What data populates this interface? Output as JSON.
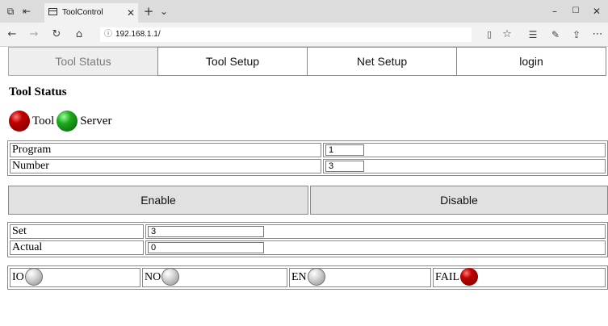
{
  "browser": {
    "tab_title": "ToolControl",
    "url": "192.168.1.1/"
  },
  "nav": {
    "items": [
      {
        "label": "Tool Status",
        "active": true
      },
      {
        "label": "Tool Setup",
        "active": false
      },
      {
        "label": "Net Setup",
        "active": false
      },
      {
        "label": "login",
        "active": false
      }
    ]
  },
  "page": {
    "title": "Tool Status"
  },
  "status": {
    "tool_label": "Tool",
    "tool_color": "#c20000",
    "server_label": "Server",
    "server_color": "#1ca81c"
  },
  "program": {
    "program_label": "Program",
    "program_value": "1",
    "number_label": "Number",
    "number_value": "3"
  },
  "controls": {
    "enable_label": "Enable",
    "disable_label": "Disable"
  },
  "counts": {
    "set_label": "Set",
    "set_value": "3",
    "actual_label": "Actual",
    "actual_value": "0"
  },
  "io": {
    "items": [
      {
        "label": "IO",
        "state": "off",
        "color": "#d4d4d4"
      },
      {
        "label": "NO",
        "state": "off",
        "color": "#d4d4d4"
      },
      {
        "label": "EN",
        "state": "off",
        "color": "#d4d4d4"
      },
      {
        "label": "FAIL",
        "state": "on",
        "color": "#c20000"
      }
    ]
  }
}
